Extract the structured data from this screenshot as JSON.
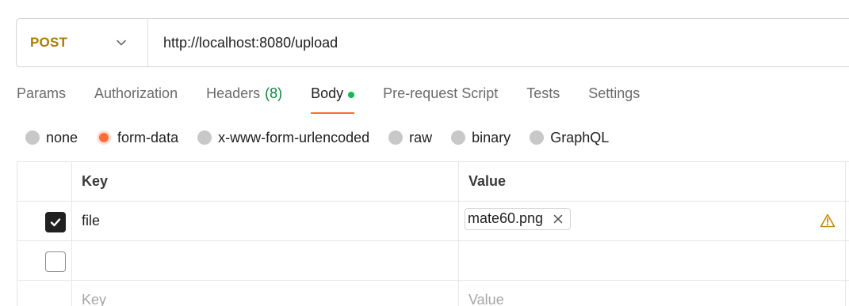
{
  "request": {
    "method": "POST",
    "url": "http://localhost:8080/upload"
  },
  "tabs": [
    {
      "label": "Params"
    },
    {
      "label": "Authorization"
    },
    {
      "label": "Headers",
      "count": "(8)"
    },
    {
      "label": "Body",
      "active": true,
      "indicator": "green-dot"
    },
    {
      "label": "Pre-request Script"
    },
    {
      "label": "Tests"
    },
    {
      "label": "Settings"
    }
  ],
  "body_types": [
    {
      "label": "none"
    },
    {
      "label": "form-data",
      "selected": true
    },
    {
      "label": "x-www-form-urlencoded"
    },
    {
      "label": "raw"
    },
    {
      "label": "binary"
    },
    {
      "label": "GraphQL"
    }
  ],
  "table": {
    "headers": {
      "key": "Key",
      "value": "Value"
    },
    "rows": [
      {
        "checked": true,
        "key": "file",
        "value_file": "mate60.png",
        "warning": true
      },
      {
        "checked": false,
        "key": "",
        "value": ""
      }
    ],
    "new_row": {
      "key_placeholder": "Key",
      "value_placeholder": "Value"
    }
  },
  "colors": {
    "method": "#ad7a03",
    "accent": "#ff6c37",
    "count": "#0b8a3e",
    "dot": "#0cbb52",
    "warning": "#c28b00"
  },
  "icons": {
    "method_dropdown": "chevron-down-icon",
    "remove_file": "close-icon",
    "row_warning": "warning-icon",
    "checked": "checkmark-icon"
  }
}
